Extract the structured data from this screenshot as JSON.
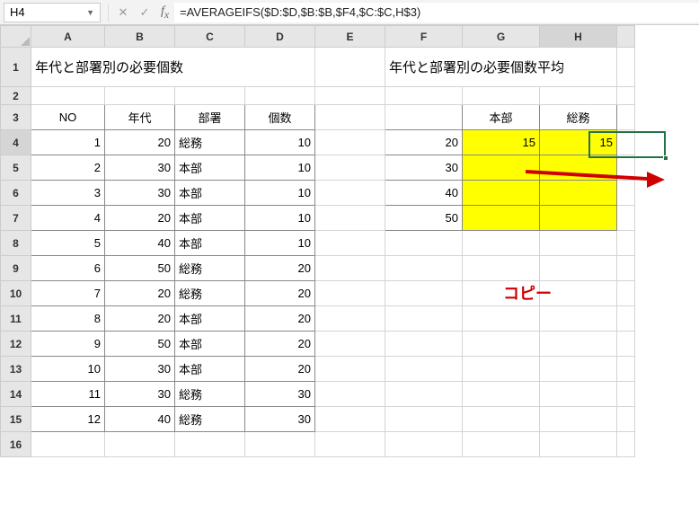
{
  "name_box": "H4",
  "formula": "=AVERAGEIFS($D:$D,$B:$B,$F4,$C:$C,H$3)",
  "columns": [
    "A",
    "B",
    "C",
    "D",
    "E",
    "F",
    "G",
    "H",
    ""
  ],
  "col_widths": [
    "c-a",
    "c-b",
    "c-c",
    "c-d",
    "c-e",
    "c-f",
    "c-g",
    "c-h",
    "c-i"
  ],
  "rows": [
    "1",
    "2",
    "3",
    "4",
    "5",
    "6",
    "7",
    "8",
    "9",
    "10",
    "11",
    "12",
    "13",
    "14",
    "15",
    "16"
  ],
  "selected_col": "H",
  "selected_row": "4",
  "title_left": "年代と部署別の必要個数",
  "title_right": "年代と部署別の必要個数平均",
  "hdr_no": "NO",
  "hdr_era": "年代",
  "hdr_dept": "部署",
  "hdr_qty": "個数",
  "hdr_honbu": "本部",
  "hdr_somu": "総務",
  "left_rows": [
    {
      "no": "1",
      "era": "20",
      "dept": "総務",
      "qty": "10"
    },
    {
      "no": "2",
      "era": "30",
      "dept": "本部",
      "qty": "10"
    },
    {
      "no": "3",
      "era": "30",
      "dept": "本部",
      "qty": "10"
    },
    {
      "no": "4",
      "era": "20",
      "dept": "本部",
      "qty": "10"
    },
    {
      "no": "5",
      "era": "40",
      "dept": "本部",
      "qty": "10"
    },
    {
      "no": "6",
      "era": "50",
      "dept": "総務",
      "qty": "20"
    },
    {
      "no": "7",
      "era": "20",
      "dept": "総務",
      "qty": "20"
    },
    {
      "no": "8",
      "era": "20",
      "dept": "本部",
      "qty": "20"
    },
    {
      "no": "9",
      "era": "50",
      "dept": "本部",
      "qty": "20"
    },
    {
      "no": "10",
      "era": "30",
      "dept": "本部",
      "qty": "20"
    },
    {
      "no": "11",
      "era": "30",
      "dept": "総務",
      "qty": "30"
    },
    {
      "no": "12",
      "era": "40",
      "dept": "総務",
      "qty": "30"
    }
  ],
  "right_rows": [
    {
      "era": "20",
      "g": "15",
      "h": "15"
    },
    {
      "era": "30",
      "g": "",
      "h": ""
    },
    {
      "era": "40",
      "g": "",
      "h": ""
    },
    {
      "era": "50",
      "g": "",
      "h": ""
    }
  ],
  "annotation": "コピー"
}
